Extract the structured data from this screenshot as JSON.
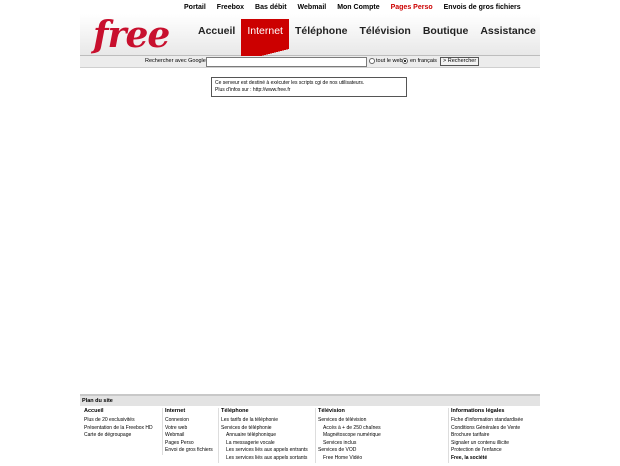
{
  "top_links": [
    "Portail",
    "Freebox",
    "Bas débit",
    "Webmail",
    "Mon Compte",
    "Pages Perso",
    "Envois de gros fichiers"
  ],
  "top_links_active_index": 5,
  "logo": "free",
  "nav": [
    "Accueil",
    "Internet",
    "Téléphone",
    "Télévision",
    "Boutique",
    "Assistance"
  ],
  "nav_active_index": 1,
  "search": {
    "label": "Rechercher avec Google",
    "value": "",
    "opt_web": "tout le web",
    "opt_fr": "en français",
    "button": "> Rechercher"
  },
  "message": {
    "line1": "Ce serveur est destiné à exécuter les scripts cgi de nos utilisateurs.",
    "line2": "Plus d'infos sur : http://www.free.fr"
  },
  "sitemap": {
    "title": "Plan du site",
    "accueil": {
      "head": "Accueil",
      "links": [
        "Plus de 20 exclusivités",
        "Présentation de la Freebox HD",
        "Carte de dégroupage"
      ]
    },
    "internet": {
      "head": "Internet",
      "links": [
        "Connexion",
        "Votre web",
        "Webmail",
        "Pages Perso",
        "Envoi de gros fichiers"
      ]
    },
    "telephone": {
      "head": "Téléphone",
      "links": [
        "Les tarifs de la téléphonie",
        "Services de téléphonie",
        "Annuaire téléphonique",
        "La messagerie vocale",
        "Les services liés aux appels entrants",
        "Les services liés aux appels sortants"
      ]
    },
    "television": {
      "head": "Télévision",
      "links": [
        "Services de télévision",
        "Accès à + de 250 chaînes",
        "Magnétoscope numérique",
        "Services inclus",
        "Services de VOD",
        "Free Home Vidéo"
      ]
    },
    "legal": {
      "head": "Informations légales",
      "links": [
        "Fiche d'information standardisée",
        "Conditions Générales de Vente",
        "Brochure tarifaire",
        "Signaler un contenu illicite",
        "Protection de l'enfance",
        "Free, la société"
      ]
    }
  }
}
